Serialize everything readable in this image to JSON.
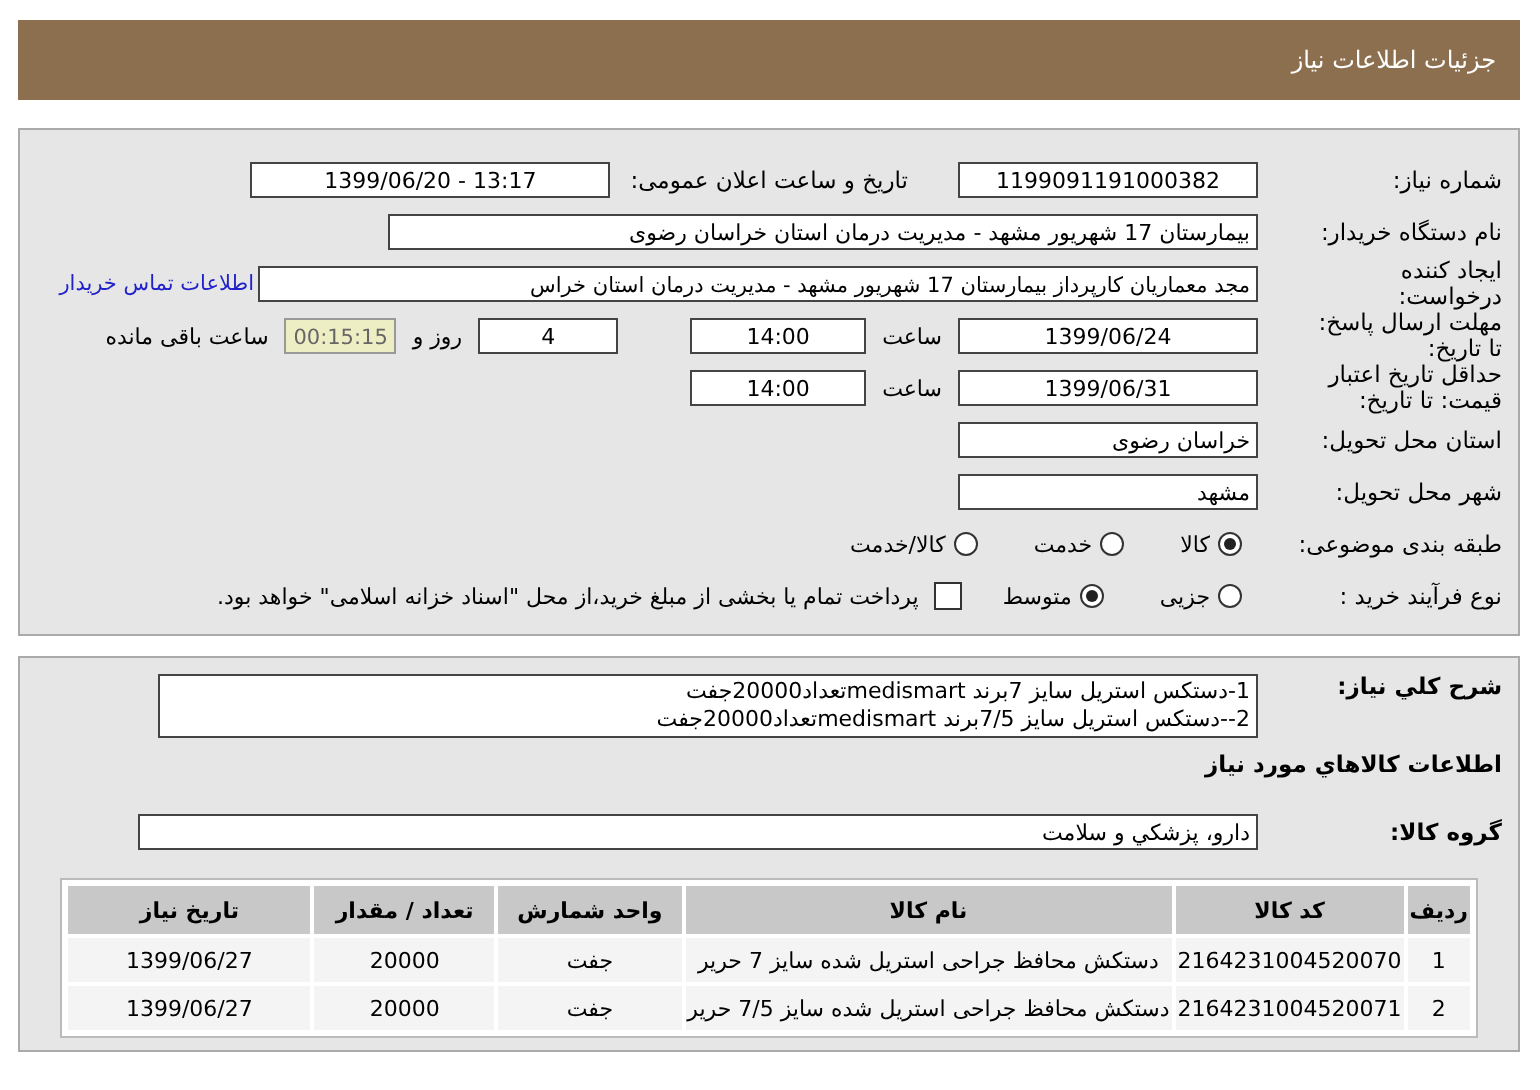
{
  "header": {
    "title": "جزئیات اطلاعات نیاز"
  },
  "need_number": {
    "label": "شماره نیاز:",
    "value": "1199091191000382"
  },
  "announce": {
    "label": "تاریخ و ساعت اعلان عمومی:",
    "value": "1399/06/20 - 13:17"
  },
  "buyer": {
    "label": "نام دستگاه خریدار:",
    "value": "بیمارستان 17 شهریور مشهد - مدیریت درمان استان خراسان رضوی"
  },
  "requester": {
    "label_lines": [
      "ایجاد کننده",
      "درخواست:"
    ],
    "value": "مجد معماریان کارپرداز بیمارستان 17 شهریور مشهد - مدیریت درمان استان خراس",
    "link": "اطلاعات تماس خریدار"
  },
  "deadline": {
    "label_lines": [
      "مهلت ارسال پاسخ:",
      "تا تاریخ:"
    ],
    "date": "1399/06/24",
    "time_label": "ساعت",
    "time": "14:00",
    "days": "4",
    "days_label": "روز و",
    "remaining": "00:15:15",
    "remaining_label": "ساعت باقی مانده"
  },
  "validity": {
    "label_lines": [
      "حداقل تاریخ اعتبار",
      "قیمت: تا تاریخ:"
    ],
    "date": "1399/06/31",
    "time_label": "ساعت",
    "time": "14:00"
  },
  "province": {
    "label": "استان محل تحویل:",
    "value": "خراسان رضوی"
  },
  "city": {
    "label": "شهر محل تحویل:",
    "value": "مشهد"
  },
  "category": {
    "label": "طبقه بندی موضوعی:",
    "options": [
      {
        "label": "کالا",
        "selected": true
      },
      {
        "label": "خدمت",
        "selected": false
      },
      {
        "label": "کالا/خدمت",
        "selected": false
      }
    ]
  },
  "process": {
    "label": "نوع فرآیند خرید :",
    "options": [
      {
        "label": "جزیی",
        "selected": false
      },
      {
        "label": "متوسط",
        "selected": true
      }
    ],
    "payment": {
      "label": "پرداخت تمام یا بخشی از مبلغ خرید،از محل \"اسناد خزانه اسلامی\" خواهد بود.",
      "checked": false
    }
  },
  "description": {
    "label": "شرح کلي نياز:",
    "lines": [
      "1-دستکس استریل سایز 7برند medismartتعداد20000جفت",
      "2--دستکس استریل سایز 7/5برند medismartتعداد20000جفت"
    ]
  },
  "goods_heading": "اطلاعات کالاهاي مورد نياز",
  "goods_group": {
    "label": "گروه کالا:",
    "value": "دارو، پزشکي و سلامت"
  },
  "table": {
    "columns": [
      "ردیف",
      "کد کالا",
      "نام کالا",
      "واحد شمارش",
      "تعداد / مقدار",
      "تاریخ نیاز"
    ],
    "rows": [
      [
        "1",
        "2164231004520070",
        "دستکش محافظ جراحی استریل شده سایز 7 حریر",
        "جفت",
        "20000",
        "1399/06/27"
      ],
      [
        "2",
        "2164231004520071",
        "دستکش محافظ جراحی استریل شده سایز 7/5 حریر",
        "جفت",
        "20000",
        "1399/06/27"
      ]
    ]
  }
}
